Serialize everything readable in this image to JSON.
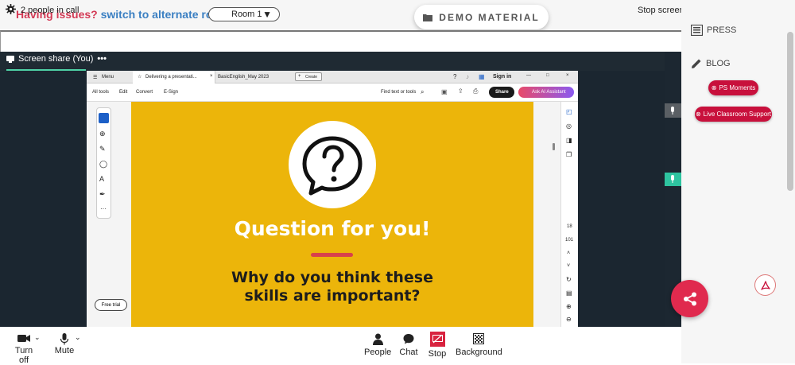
{
  "topbar": {
    "issue_text": "Having issues?",
    "switch_text": "switch to alternate room",
    "room_value": "Room 1",
    "demo_label": "DEMO MATERIAL"
  },
  "call": {
    "people_count": "2 people in call",
    "stop_screen": "Stop screen"
  },
  "stage": {
    "tab_label": "Screen share (You)"
  },
  "acrobat": {
    "menu": "Menu",
    "tab1": "Delivering a presentati...",
    "tab2": "BasicEnglish_May 2023",
    "create": "Create",
    "sign_in": "Sign in",
    "tools": [
      "All tools",
      "Edit",
      "Convert",
      "E-Sign"
    ],
    "find": "Find text or tools",
    "share": "Share",
    "ai": "Ask AI Assistant",
    "free_trial": "Free trial",
    "page_num": "18",
    "page_total": "101"
  },
  "slide": {
    "title": "Question for you!",
    "question": "Why do you think these skills are important?"
  },
  "controls": {
    "camera": "Turn off",
    "mic": "Mute",
    "people": "People",
    "chat": "Chat",
    "stop": "Stop",
    "background": "Background"
  },
  "sidebar": {
    "press": "PRESS",
    "blog": "BLOG",
    "ps_moments": "PS Moments",
    "live_support": "Live Classroom Support"
  },
  "colors": {
    "slide_bg": "#ecb50a",
    "accent_red": "#c8103c",
    "share_fab": "#e02a4e",
    "screen_tab_line": "#4fd1a5"
  }
}
